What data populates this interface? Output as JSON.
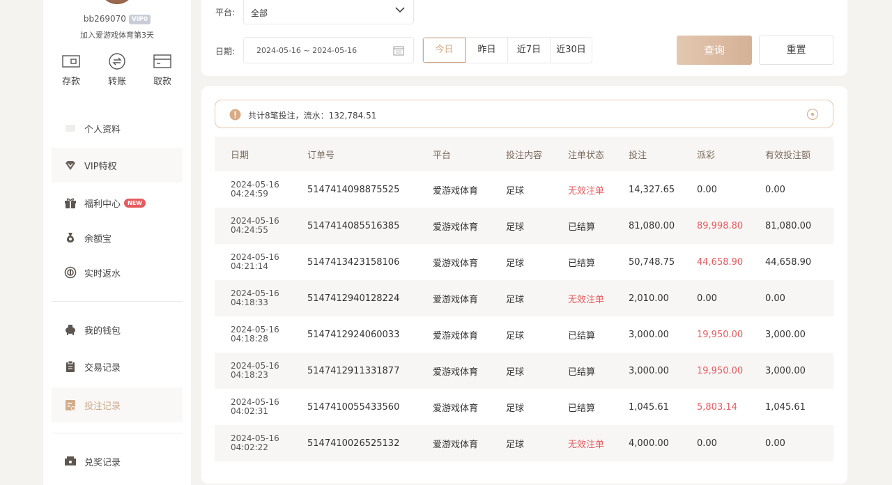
{
  "user": {
    "username": "bb269070",
    "vip_badge": "VIP0",
    "joined_text": "加入爱游戏体育第3天"
  },
  "quick_actions": [
    {
      "label": "存款",
      "icon": "wallet-icon"
    },
    {
      "label": "转账",
      "icon": "transfer-icon"
    },
    {
      "label": "取款",
      "icon": "card-icon"
    }
  ],
  "menu": {
    "profile": "个人资料",
    "vip": "VIP特权",
    "welfare": "福利中心",
    "welfare_badge": "NEW",
    "balance": "余额宝",
    "rebate": "实时返水",
    "wallet": "我的钱包",
    "transactions": "交易记录",
    "bets": "投注记录",
    "redeem": "兑奖记录"
  },
  "filters": {
    "platform_label": "平台:",
    "platform_value": "全部",
    "date_label": "日期:",
    "date_value": "2024-05-16 ~ 2024-05-16",
    "ranges": [
      "今日",
      "昨日",
      "近7日",
      "近30日"
    ],
    "active_range": "今日",
    "query_button": "查询",
    "reset_button": "重置"
  },
  "summary": "共计8笔投注，流水：132,784.51",
  "table": {
    "headers": [
      "日期",
      "订单号",
      "平台",
      "投注内容",
      "注单状态",
      "投注",
      "派彩",
      "有效投注额"
    ],
    "rows": [
      {
        "date": "2024-05-16",
        "time": "04:24:59",
        "order": "5147414098875525",
        "platform": "爱游戏体育",
        "content": "足球",
        "status": "无效注单",
        "bet": "14,327.65",
        "payout": "0.00",
        "valid": "0.00"
      },
      {
        "date": "2024-05-16",
        "time": "04:24:55",
        "order": "5147414085516385",
        "platform": "爱游戏体育",
        "content": "足球",
        "status": "已结算",
        "bet": "81,080.00",
        "payout": "89,998.80",
        "valid": "81,080.00"
      },
      {
        "date": "2024-05-16",
        "time": "04:21:14",
        "order": "5147413423158106",
        "platform": "爱游戏体育",
        "content": "足球",
        "status": "已结算",
        "bet": "50,748.75",
        "payout": "44,658.90",
        "valid": "44,658.90"
      },
      {
        "date": "2024-05-16",
        "time": "04:18:33",
        "order": "5147412940128224",
        "platform": "爱游戏体育",
        "content": "足球",
        "status": "无效注单",
        "bet": "2,010.00",
        "payout": "0.00",
        "valid": "0.00"
      },
      {
        "date": "2024-05-16",
        "time": "04:18:28",
        "order": "5147412924060033",
        "platform": "爱游戏体育",
        "content": "足球",
        "status": "已结算",
        "bet": "3,000.00",
        "payout": "19,950.00",
        "valid": "3,000.00"
      },
      {
        "date": "2024-05-16",
        "time": "04:18:23",
        "order": "5147412911331877",
        "platform": "爱游戏体育",
        "content": "足球",
        "status": "已结算",
        "bet": "3,000.00",
        "payout": "19,950.00",
        "valid": "3,000.00"
      },
      {
        "date": "2024-05-16",
        "time": "04:02:31",
        "order": "5147410055433560",
        "platform": "爱游戏体育",
        "content": "足球",
        "status": "已结算",
        "bet": "1,045.61",
        "payout": "5,803.14",
        "valid": "1,045.61"
      },
      {
        "date": "2024-05-16",
        "time": "04:02:22",
        "order": "5147410026525132",
        "platform": "爱游戏体育",
        "content": "足球",
        "status": "无效注单",
        "bet": "4,000.00",
        "payout": "0.00",
        "valid": "0.00"
      }
    ]
  },
  "colors": {
    "accent": "#d2a783",
    "negative": "#e45b60",
    "panel": "#ffffff",
    "background": "#f5f3f0"
  }
}
